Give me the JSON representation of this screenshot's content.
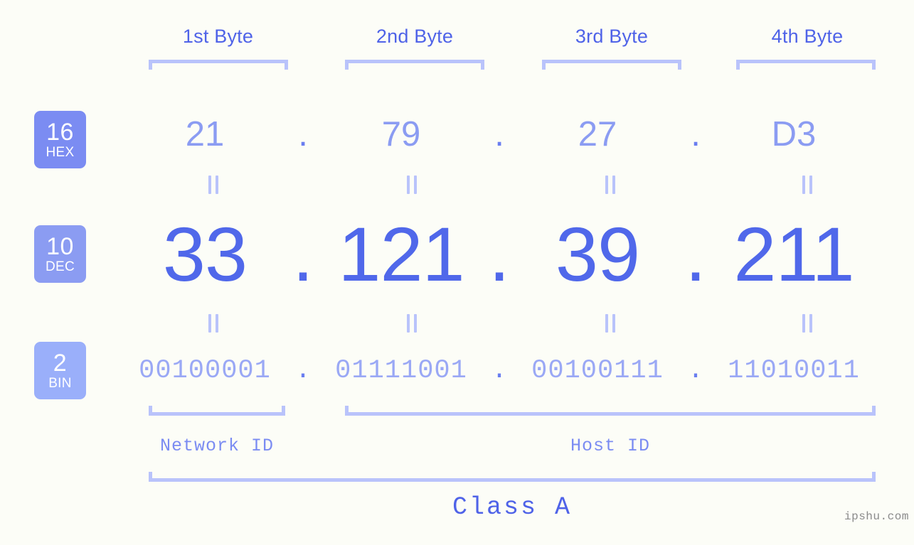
{
  "page": {
    "background_color": "#fcfdf7",
    "watermark": "ipshu.com"
  },
  "bytes": [
    {
      "label": "1st Byte"
    },
    {
      "label": "2nd Byte"
    },
    {
      "label": "3rd Byte"
    },
    {
      "label": "4th Byte"
    }
  ],
  "bases": [
    {
      "number": "16",
      "name": "HEX",
      "color": "#7b8cf2"
    },
    {
      "number": "10",
      "name": "DEC",
      "color": "#8b9cf2"
    },
    {
      "number": "2",
      "name": "BIN",
      "color": "#9aaffa"
    }
  ],
  "separator": ".",
  "rows": {
    "hex": {
      "base_number": "16",
      "base_name": "HEX",
      "values": [
        "21",
        "79",
        "27",
        "D3"
      ],
      "text_color": "#8b9cf2"
    },
    "dec": {
      "base_number": "10",
      "base_name": "DEC",
      "values": [
        "33",
        "121",
        "39",
        "211"
      ],
      "text_color": "#5068ea"
    },
    "bin": {
      "base_number": "2",
      "base_name": "BIN",
      "values": [
        "00100001",
        "01111001",
        "00100111",
        "11010011"
      ],
      "text_color": "#9aa8f5"
    }
  },
  "footer": {
    "network_id_label": "Network ID",
    "host_id_label": "Host ID",
    "class_label": "Class A"
  },
  "colors": {
    "accent": "#4f63e8",
    "bracket": "#b9c3fb",
    "dec_text": "#5068ea",
    "hex_text": "#8b9cf2",
    "bin_text": "#9aa8f5"
  }
}
